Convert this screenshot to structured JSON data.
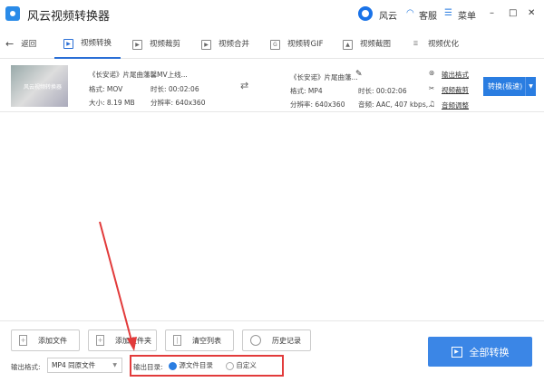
{
  "app": {
    "title": "风云视频转换器",
    "brand": "风云",
    "service": "客服",
    "menu": "菜单"
  },
  "nav": {
    "back": "返回",
    "tabs": [
      {
        "label": "视频转换",
        "icon": "play-icon"
      },
      {
        "label": "视频裁剪",
        "icon": "crop-icon"
      },
      {
        "label": "视频合并",
        "icon": "merge-icon"
      },
      {
        "label": "视频转GIF",
        "icon": "gif-icon"
      },
      {
        "label": "视频截图",
        "icon": "image-icon"
      },
      {
        "label": "视频优化",
        "icon": "sliders-icon"
      }
    ]
  },
  "file": {
    "thumb_text": "风云视频转换器",
    "src_name": "《长安诺》片尾曲藩馨MV上线...",
    "src_format": "格式: MOV",
    "src_duration": "时长: 00:02:06",
    "src_size": "大小: 8.19 MB",
    "src_resolution": "分辨率: 640x360",
    "out_name": "《长安诺》片尾曲藩...",
    "out_format": "格式: MP4",
    "out_duration": "时长: 00:02:06",
    "out_resolution": "分辨率: 640x360",
    "out_audio": "音频: AAC, 407 kbps,...",
    "actions": [
      "输出格式",
      "视频裁剪",
      "音频调整"
    ],
    "convert": "转换(极速)"
  },
  "bottom": {
    "buttons": [
      "添加文件",
      "添加文件夹",
      "清空列表",
      "历史记录"
    ],
    "format_label": "输出格式:",
    "format_value": "MP4 同原文件",
    "dir_label": "输出目录:",
    "dir_source": "源文件目录",
    "dir_custom": "自定义",
    "convert_all": "全部转换"
  },
  "colors": {
    "accent": "#2a7de1",
    "highlight": "#e23b3b"
  }
}
